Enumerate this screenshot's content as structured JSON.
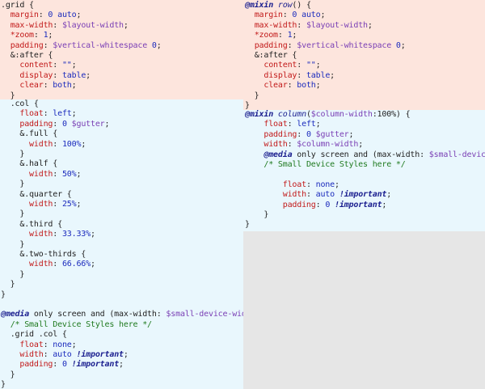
{
  "colors": {
    "left_top_bg": "#fde5dd",
    "left_bottom_bg": "#e9f7fd",
    "right_top_bg": "#fde5dd",
    "right_bottom_bg": "#e9f7fd",
    "empty_bg": "#e6e6e6"
  },
  "left_top": [
    [
      [
        ".grid {",
        "sel"
      ]
    ],
    [
      [
        "  ",
        ""
      ],
      [
        "margin",
        ""
      ],
      [
        ": ",
        ""
      ],
      [
        "0 auto",
        "vl"
      ],
      [
        ";",
        ""
      ]
    ],
    [
      [
        "  ",
        ""
      ],
      [
        "max-width",
        ""
      ],
      [
        ": ",
        ""
      ],
      [
        "$layout-width",
        "var"
      ],
      [
        ";",
        ""
      ]
    ],
    [
      [
        "  ",
        ""
      ],
      [
        "*zoom",
        ""
      ],
      [
        ": ",
        ""
      ],
      [
        "1",
        "vl"
      ],
      [
        ";",
        ""
      ]
    ],
    [
      [
        "  ",
        ""
      ],
      [
        "padding",
        ""
      ],
      [
        ": ",
        ""
      ],
      [
        "$vertical-whitespace",
        "var"
      ],
      [
        " ",
        ""
      ],
      [
        "0",
        "vl"
      ],
      [
        ";",
        ""
      ]
    ],
    [
      [
        "  ",
        ""
      ],
      [
        "&:after {",
        "sel"
      ]
    ],
    [
      [
        "    ",
        ""
      ],
      [
        "content",
        ""
      ],
      [
        ": ",
        ""
      ],
      [
        "\"\"",
        "vl"
      ],
      [
        ";",
        ""
      ]
    ],
    [
      [
        "    ",
        ""
      ],
      [
        "display",
        ""
      ],
      [
        ": ",
        ""
      ],
      [
        "table",
        "vl"
      ],
      [
        ";",
        ""
      ]
    ],
    [
      [
        "    ",
        ""
      ],
      [
        "clear",
        ""
      ],
      [
        ": ",
        ""
      ],
      [
        "both",
        "vl"
      ],
      [
        ";",
        ""
      ]
    ],
    [
      [
        "  }",
        ""
      ]
    ]
  ],
  "left_bottom": [
    [
      [
        "  ",
        ""
      ],
      [
        ".col {",
        "sel"
      ]
    ],
    [
      [
        "    ",
        ""
      ],
      [
        "float",
        ""
      ],
      [
        ": ",
        ""
      ],
      [
        "left",
        "vl"
      ],
      [
        ";",
        ""
      ]
    ],
    [
      [
        "    ",
        ""
      ],
      [
        "padding",
        ""
      ],
      [
        ": ",
        ""
      ],
      [
        "0",
        "vl"
      ],
      [
        " ",
        ""
      ],
      [
        "$gutter",
        "var"
      ],
      [
        ";",
        ""
      ]
    ],
    [
      [
        "    ",
        ""
      ],
      [
        "&.full {",
        "sel"
      ]
    ],
    [
      [
        "      ",
        ""
      ],
      [
        "width",
        ""
      ],
      [
        ": ",
        ""
      ],
      [
        "100%",
        "vl"
      ],
      [
        ";",
        ""
      ]
    ],
    [
      [
        "    }",
        ""
      ]
    ],
    [
      [
        "    ",
        ""
      ],
      [
        "&.half {",
        "sel"
      ]
    ],
    [
      [
        "      ",
        ""
      ],
      [
        "width",
        ""
      ],
      [
        ": ",
        ""
      ],
      [
        "50%",
        "vl"
      ],
      [
        ";",
        ""
      ]
    ],
    [
      [
        "    }",
        ""
      ]
    ],
    [
      [
        "    ",
        ""
      ],
      [
        "&.quarter {",
        "sel"
      ]
    ],
    [
      [
        "      ",
        ""
      ],
      [
        "width",
        ""
      ],
      [
        ": ",
        ""
      ],
      [
        "25%",
        "vl"
      ],
      [
        ";",
        ""
      ]
    ],
    [
      [
        "    }",
        ""
      ]
    ],
    [
      [
        "    ",
        ""
      ],
      [
        "&.third {",
        "sel"
      ]
    ],
    [
      [
        "      ",
        ""
      ],
      [
        "width",
        ""
      ],
      [
        ": ",
        ""
      ],
      [
        "33.33%",
        "vl"
      ],
      [
        ";",
        ""
      ]
    ],
    [
      [
        "    }",
        ""
      ]
    ],
    [
      [
        "    ",
        ""
      ],
      [
        "&.two-thirds {",
        "sel"
      ]
    ],
    [
      [
        "      ",
        ""
      ],
      [
        "width",
        ""
      ],
      [
        ": ",
        ""
      ],
      [
        "66.66%",
        "vl"
      ],
      [
        ";",
        ""
      ]
    ],
    [
      [
        "    }",
        ""
      ]
    ],
    [
      [
        "  }",
        ""
      ]
    ],
    [
      [
        "}",
        ""
      ]
    ],
    [
      [
        "",
        ""
      ]
    ],
    [
      [
        "@media",
        "at"
      ],
      [
        " only screen and (max-width: ",
        ""
      ],
      [
        "$small-device-width",
        "var"
      ],
      [
        ") {",
        ""
      ]
    ],
    [
      [
        "  ",
        ""
      ],
      [
        "/* Small Device Styles here */",
        "cm"
      ]
    ],
    [
      [
        "  ",
        ""
      ],
      [
        ".grid .col {",
        "sel"
      ]
    ],
    [
      [
        "    ",
        ""
      ],
      [
        "float",
        ""
      ],
      [
        ": ",
        ""
      ],
      [
        "none",
        "vl"
      ],
      [
        ";",
        ""
      ]
    ],
    [
      [
        "    ",
        ""
      ],
      [
        "width",
        ""
      ],
      [
        ": ",
        ""
      ],
      [
        "auto",
        "vl"
      ],
      [
        " ",
        ""
      ],
      [
        "!important",
        "imp"
      ],
      [
        ";",
        ""
      ]
    ],
    [
      [
        "    ",
        ""
      ],
      [
        "padding",
        ""
      ],
      [
        ": ",
        ""
      ],
      [
        "0",
        "vl"
      ],
      [
        " ",
        ""
      ],
      [
        "!important",
        "imp"
      ],
      [
        ";",
        ""
      ]
    ],
    [
      [
        "  }",
        ""
      ]
    ],
    [
      [
        "}",
        ""
      ]
    ]
  ],
  "right_top": [
    [
      [
        "@mixin",
        "at"
      ],
      [
        " ",
        ""
      ],
      [
        "row",
        "fn"
      ],
      [
        "() {",
        ""
      ]
    ],
    [
      [
        "  ",
        ""
      ],
      [
        "margin",
        ""
      ],
      [
        ": ",
        ""
      ],
      [
        "0 auto",
        "vl"
      ],
      [
        ";",
        ""
      ]
    ],
    [
      [
        "  ",
        ""
      ],
      [
        "max-width",
        ""
      ],
      [
        ": ",
        ""
      ],
      [
        "$layout-width",
        "var"
      ],
      [
        ";",
        ""
      ]
    ],
    [
      [
        "  ",
        ""
      ],
      [
        "*zoom",
        ""
      ],
      [
        ": ",
        ""
      ],
      [
        "1",
        "vl"
      ],
      [
        ";",
        ""
      ]
    ],
    [
      [
        "  ",
        ""
      ],
      [
        "padding",
        ""
      ],
      [
        ": ",
        ""
      ],
      [
        "$vertical-whitespace",
        "var"
      ],
      [
        " ",
        ""
      ],
      [
        "0",
        "vl"
      ],
      [
        ";",
        ""
      ]
    ],
    [
      [
        "  ",
        ""
      ],
      [
        "&:after {",
        "sel"
      ]
    ],
    [
      [
        "    ",
        ""
      ],
      [
        "content",
        ""
      ],
      [
        ": ",
        ""
      ],
      [
        "\"\"",
        "vl"
      ],
      [
        ";",
        ""
      ]
    ],
    [
      [
        "    ",
        ""
      ],
      [
        "display",
        ""
      ],
      [
        ": ",
        ""
      ],
      [
        "table",
        "vl"
      ],
      [
        ";",
        ""
      ]
    ],
    [
      [
        "    ",
        ""
      ],
      [
        "clear",
        ""
      ],
      [
        ": ",
        ""
      ],
      [
        "both",
        "vl"
      ],
      [
        ";",
        ""
      ]
    ],
    [
      [
        "  }",
        ""
      ]
    ],
    [
      [
        "}",
        ""
      ]
    ]
  ],
  "right_bottom": [
    [
      [
        "@mixin",
        "at"
      ],
      [
        " ",
        ""
      ],
      [
        "column",
        "fn"
      ],
      [
        "(",
        ""
      ],
      [
        "$column-width",
        "var"
      ],
      [
        ":100%) {",
        ""
      ]
    ],
    [
      [
        "    ",
        ""
      ],
      [
        "float",
        ""
      ],
      [
        ": ",
        ""
      ],
      [
        "left",
        "vl"
      ],
      [
        ";",
        ""
      ]
    ],
    [
      [
        "    ",
        ""
      ],
      [
        "padding",
        ""
      ],
      [
        ": ",
        ""
      ],
      [
        "0",
        "vl"
      ],
      [
        " ",
        ""
      ],
      [
        "$gutter",
        "var"
      ],
      [
        ";",
        ""
      ]
    ],
    [
      [
        "    ",
        ""
      ],
      [
        "width",
        ""
      ],
      [
        ": ",
        ""
      ],
      [
        "$column-width",
        "var"
      ],
      [
        ";",
        ""
      ]
    ],
    [
      [
        "    ",
        ""
      ],
      [
        "@media",
        "at"
      ],
      [
        " only screen and (max-width: ",
        ""
      ],
      [
        "$small-device-width",
        "var"
      ]
    ],
    [
      [
        "    ",
        ""
      ],
      [
        "/* Small Device Styles here */",
        "cm"
      ]
    ],
    [
      [
        "",
        ""
      ]
    ],
    [
      [
        "        ",
        ""
      ],
      [
        "float",
        ""
      ],
      [
        ": ",
        ""
      ],
      [
        "none",
        "vl"
      ],
      [
        ";",
        ""
      ]
    ],
    [
      [
        "        ",
        ""
      ],
      [
        "width",
        ""
      ],
      [
        ": ",
        ""
      ],
      [
        "auto",
        "vl"
      ],
      [
        " ",
        ""
      ],
      [
        "!important",
        "imp"
      ],
      [
        ";",
        ""
      ]
    ],
    [
      [
        "        ",
        ""
      ],
      [
        "padding",
        ""
      ],
      [
        ": ",
        ""
      ],
      [
        "0",
        "vl"
      ],
      [
        " ",
        ""
      ],
      [
        "!important",
        "imp"
      ],
      [
        ";",
        ""
      ]
    ],
    [
      [
        "    }",
        ""
      ]
    ],
    [
      [
        "}",
        ""
      ]
    ]
  ]
}
